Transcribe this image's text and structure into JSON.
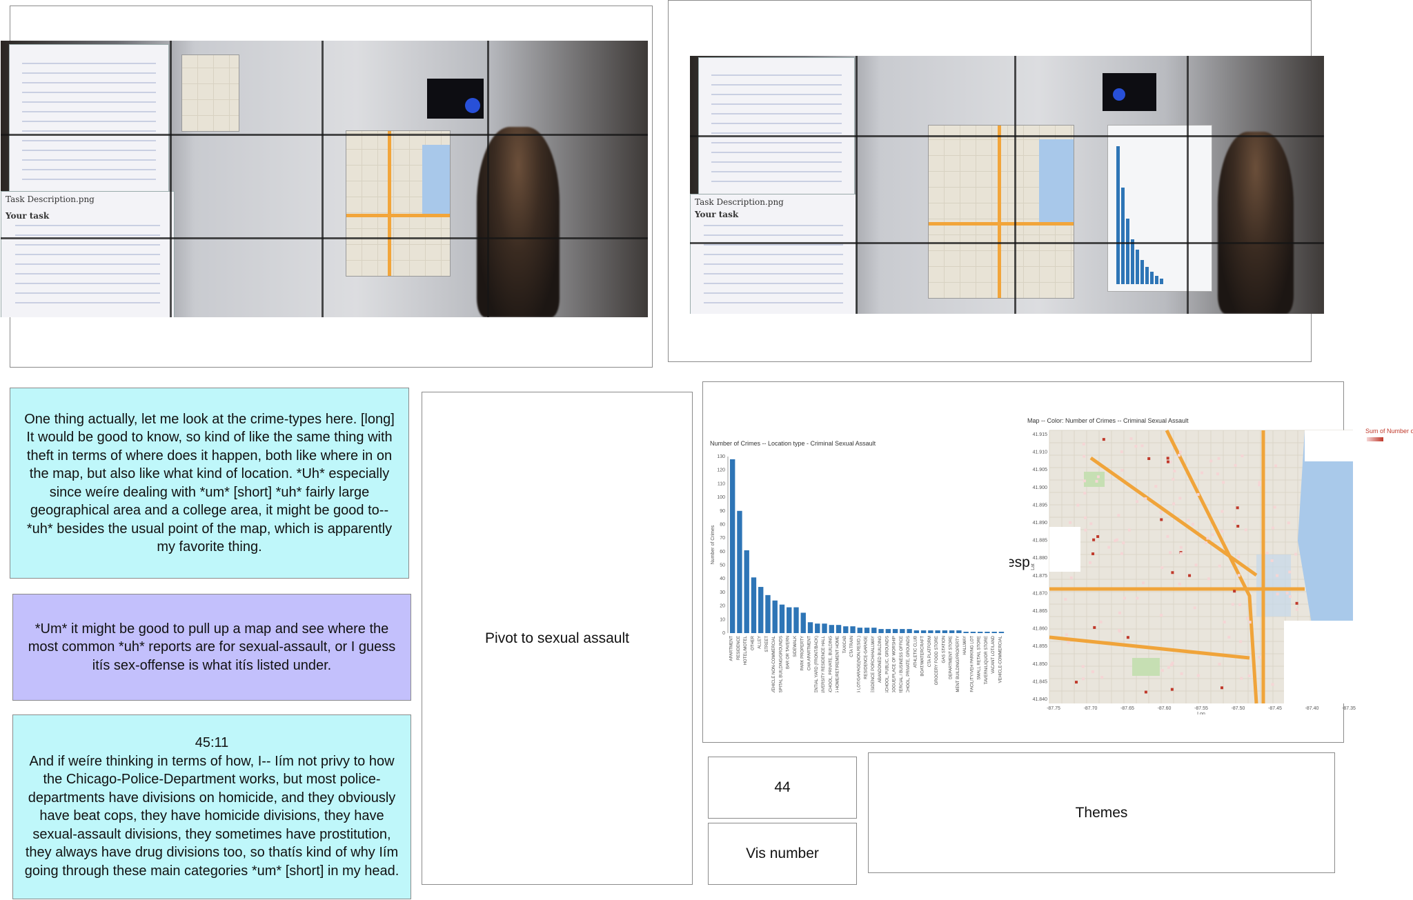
{
  "notes": {
    "note1": "One thing actually, let me look at the crime-types here. [long]\nIt would be good to know, so kind of like the same thing with theft in terms of where does it happen, both like where in on the map, but also like what kind of location. *Uh* especially since weíre dealing with *um* [short] *uh* fairly large geographical area and a college area, it might be good to-- *uh* besides the usual point of the map, which is apparently my favorite thing.",
    "note2": "*Um* it might be good to pull up a map and see where the most common *uh* reports are for sexual-assault, or I guess itís sex-offense is what itís listed under.",
    "note3": "45:11\nAnd if weíre thinking in terms of how, I-- Iím not privy to how the Chicago-Police-Department works, but most police-departments have divisions on homicide, and they obviously have beat cops, they have homicide divisions, they have sexual-assault divisions, they sometimes have prostitution, they always have drug divisions too, so thatís kind of why Iím going through these main categories *um* [short] in my head."
  },
  "labels": {
    "pivot": "Pivot to sexual assault",
    "vis_number_value": "44",
    "vis_number_label": "Vis number",
    "themes": "Themes",
    "hidden_fragment": "esp"
  },
  "photos": {
    "left_task_title": "Task Description.png",
    "left_task_heading": "Your task",
    "right_task_title": "Task Description.png",
    "right_task_heading": "Your task"
  },
  "chart_data": [
    {
      "type": "bar",
      "title": "Number of Crimes -- Location type - Criminal Sexual Assault",
      "xlabel": "",
      "ylabel": "Number of Crimes",
      "ylim": [
        0,
        130
      ],
      "yticks": [
        0,
        10,
        20,
        30,
        40,
        50,
        60,
        70,
        80,
        90,
        100,
        110,
        120,
        130
      ],
      "categories": [
        "APARTMENT",
        "RESIDENCE",
        "HOTEL/MOTEL",
        "OTHER",
        "ALLEY",
        "STREET",
        "VEHICLE NON-COMMERCIAL",
        "HOSPITAL BUILDING/GROUNDS",
        "BAR OR TAVERN",
        "SIDEWALK",
        "PARK PROPERTY",
        "CHA APARTMENT",
        "RESIDENTIAL YARD (FRONT/BACK)",
        "COLLEGE/UNIVERSITY RESIDENCE HALL",
        "SCHOOL, PRIVATE, BUILDING",
        "NURSING HOME/RETIREMENT HOME",
        "TAXICAB",
        "CTA TRAIN",
        "PARKING LOT/GARAGE(NON.RESID.)",
        "RESIDENCE-GARAGE",
        "RESIDENCE PORCH/HALLWAY",
        "ABANDONED BUILDING",
        "SCHOOL, PUBLIC, GROUNDS",
        "CHURCH/SYNAGOGUE/PLACE OF WORSHIP",
        "COMMERCIAL / BUSINESS OFFICE",
        "SCHOOL, PRIVATE, GROUNDS",
        "ATHLETIC CLUB",
        "BOAT/WATERCRAFT",
        "CTA PLATFORM",
        "GROCERY FOOD STORE",
        "GAS STATION",
        "DEPARTMENT STORE",
        "GOVERNMENT BUILDING/PROPERTY",
        "HALLWAY",
        "POLICE FACILITY/VEH PARKING LOT",
        "SMALL RETAIL STORE",
        "TAVERN/LIQUOR STORE",
        "VACANT LOT/LAND",
        "VEHICLE-COMMERCIAL"
      ],
      "values": [
        128,
        90,
        61,
        41,
        34,
        28,
        24,
        21,
        19,
        19,
        15,
        8,
        7,
        7,
        6,
        6,
        5,
        5,
        4,
        4,
        4,
        3,
        3,
        3,
        3,
        3,
        2,
        2,
        2,
        2,
        2,
        2,
        2,
        1,
        1,
        1,
        1,
        1,
        1
      ]
    },
    {
      "type": "map",
      "title": "Map -- Color: Number of Crimes -- Criminal Sexual Assault",
      "legend_title": "Sum of Number of Crimes",
      "color_low": "#f5d5d5",
      "color_high": "#c0392b",
      "yticks": [
        "41.915",
        "41.910",
        "41.905",
        "41.900",
        "41.895",
        "41.890",
        "41.885",
        "41.880",
        "41.875",
        "41.870",
        "41.865",
        "41.860",
        "41.855",
        "41.850",
        "41.845",
        "41.840"
      ],
      "xticks": [
        "-87.75",
        "-87.70",
        "-87.65",
        "-87.60",
        "-87.55",
        "-87.50",
        "-87.45",
        "-87.40",
        "-87.35"
      ],
      "xlabel": "Lon",
      "ylabel": "Lat"
    }
  ],
  "colors": {
    "cyan_note": "#bff7fa",
    "purple_note": "#c3c0fc",
    "bar_blue": "#2e75b6"
  }
}
